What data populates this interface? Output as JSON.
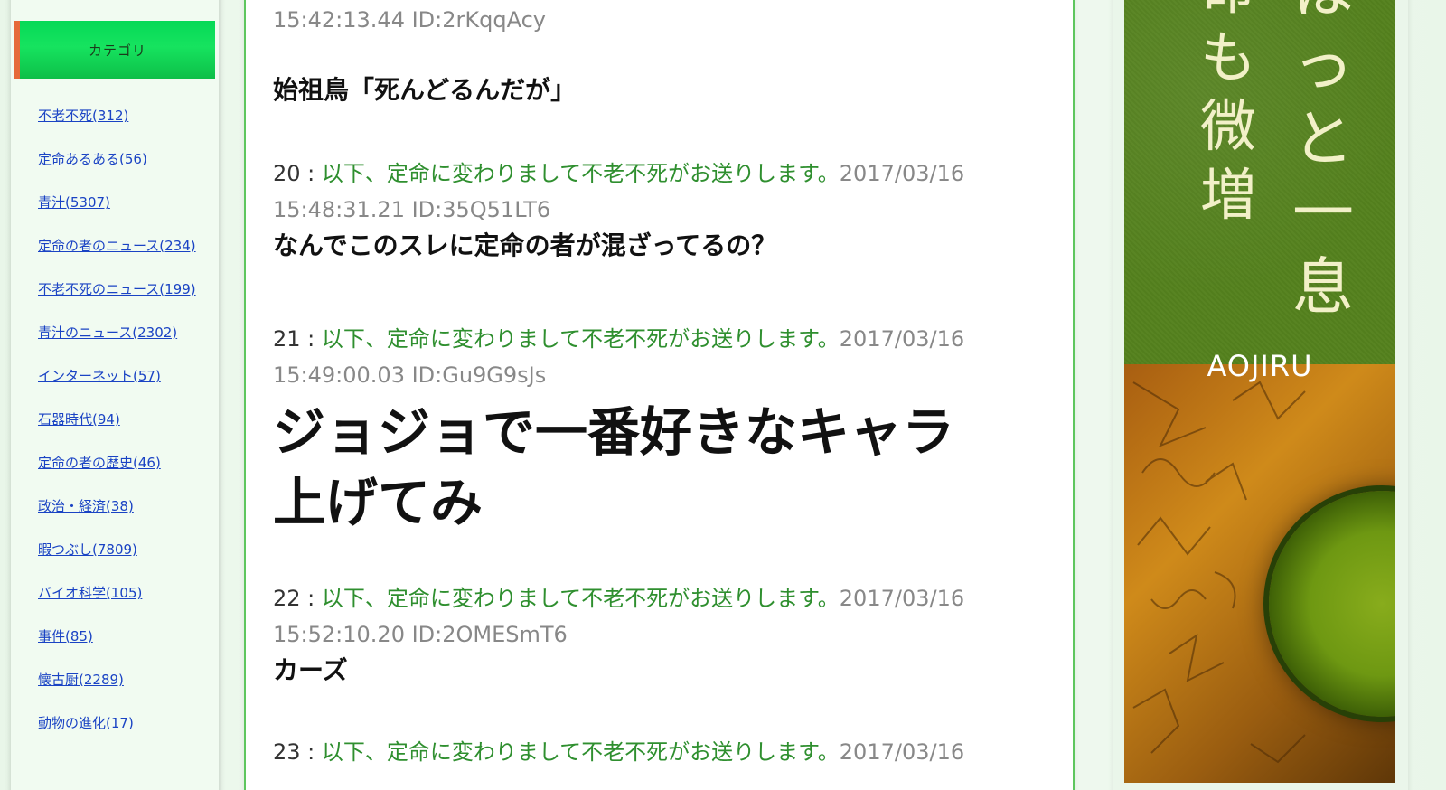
{
  "sidebar": {
    "category_header": "カテゴリ",
    "categories": [
      "不老不死(312)",
      "定命あるある(56)",
      "青汁(5307)",
      "定命の者のニュース(234)",
      "不老不死のニュース(199)",
      "青汁のニュース(2302)",
      "インターネット(57)",
      "石器時代(94)",
      "定命の者の歴史(46)",
      "政治・経済(38)",
      "暇つぶし(7809)",
      "バイオ科学(105)",
      "事件(85)",
      "懐古厨(2289)",
      "動物の進化(17)"
    ]
  },
  "thread": {
    "post19_tail": {
      "meta": "15:42:13.44 ID:2rKqqAcy",
      "body": "始祖鳥「死んどるんだが」"
    },
    "posts": [
      {
        "num": "20",
        "sep": " : ",
        "name": "以下、定命に変わりまして不老不死がお送りします。",
        "date": "2017/03/16",
        "time_id": "15:48:31.21 ID:35Q51LT6",
        "body": "なんでこのスレに定命の者が混ざってるの？"
      },
      {
        "num": "21",
        "sep": " : ",
        "name": "以下、定命に変わりまして不老不死がお送りします。",
        "date": "2017/03/16",
        "time_id": "15:49:00.03 ID:Gu9G9sJs",
        "body": "ジョジョで一番好きなキャラ上げてみ"
      },
      {
        "num": "22",
        "sep": " : ",
        "name": "以下、定命に変わりまして不老不死がお送りします。",
        "date": "2017/03/16",
        "time_id": "15:52:10.20 ID:2OMESmT6",
        "body": "カーズ"
      },
      {
        "num": "23",
        "sep": " : ",
        "name": "以下、定命に変わりまして不老不死がお送りします。",
        "date": "2017/03/16"
      }
    ]
  },
  "ad": {
    "col_right": [
      "ほ",
      "っ",
      "と",
      "一",
      "息"
    ],
    "col_left": [
      "命",
      "も",
      "微",
      "増"
    ],
    "brand": "AOJIRU",
    "colors": {
      "top_green": "#55821e",
      "tea_green": "#6e9812"
    }
  },
  "colors": {
    "link": "#1a43c4",
    "name_green": "#2f8f2f",
    "meta_gray": "#888888",
    "header_green": "#0dbf48",
    "border_green": "#5ec65e"
  }
}
